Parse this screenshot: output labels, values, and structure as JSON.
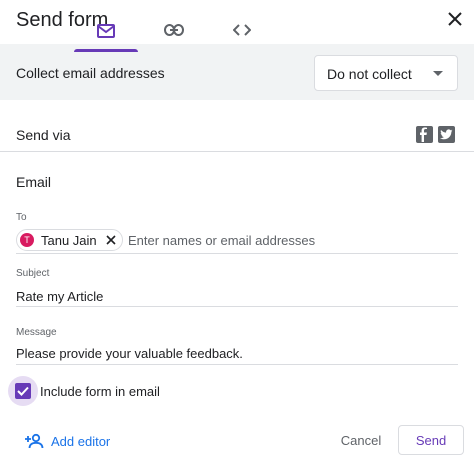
{
  "dialog": {
    "title": "Send form",
    "close_icon": "close-icon"
  },
  "collect": {
    "label": "Collect email addresses",
    "select_value": "Do not collect",
    "arrow_icon": "dropdown-arrow-icon"
  },
  "send_via": {
    "label": "Send via",
    "tabs": [
      {
        "icon": "email-icon",
        "selected": true
      },
      {
        "icon": "link-icon",
        "selected": false
      },
      {
        "icon": "embed-code-icon",
        "selected": false
      }
    ],
    "social": [
      "facebook-icon",
      "twitter-icon"
    ],
    "accent_color": "#673ab7"
  },
  "email": {
    "section_title": "Email",
    "to": {
      "label": "To",
      "recipient": {
        "initial": "T",
        "name": "Tanu Jain",
        "avatar_color": "#d81b60"
      },
      "placeholder": "Enter names or email addresses"
    },
    "subject": {
      "label": "Subject",
      "value": "Rate my Article"
    },
    "message": {
      "label": "Message",
      "value": "Please provide your valuable feedback."
    },
    "include_form": {
      "label": "Include form in email",
      "checked": true
    }
  },
  "footer": {
    "add_editor_label": "Add editor",
    "cancel_label": "Cancel",
    "send_label": "Send",
    "link_color": "#1a73e8"
  }
}
